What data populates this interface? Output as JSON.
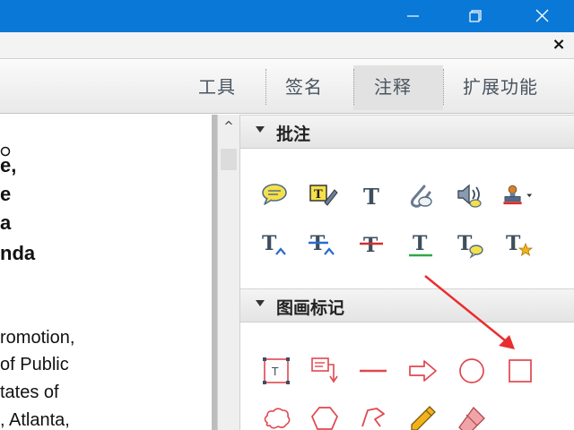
{
  "window": {
    "minimize_label": "—",
    "maximize_label": "⧉",
    "close_label": "✕"
  },
  "document_tab": {
    "close_label": "×"
  },
  "toolbar": {
    "tabs": [
      {
        "label": "工具"
      },
      {
        "label": "签名"
      },
      {
        "label": "注释"
      },
      {
        "label": "扩展功能"
      }
    ],
    "active_tab": "注释"
  },
  "document": {
    "lines": [
      "e,",
      "e",
      "a",
      "nda",
      "romotion,",
      "of Public",
      "tates of",
      ", Atlanta,"
    ]
  },
  "scrollbar": {
    "up_label": "^"
  },
  "panel": {
    "annotations": {
      "title": "批注",
      "tools": [
        {
          "icon": "sticky-note-icon"
        },
        {
          "icon": "highlight-text-icon"
        },
        {
          "icon": "add-text-icon"
        },
        {
          "icon": "attach-file-icon"
        },
        {
          "icon": "record-audio-icon"
        },
        {
          "icon": "stamp-icon"
        },
        {
          "icon": "insert-text-icon"
        },
        {
          "icon": "replace-text-icon"
        },
        {
          "icon": "strikethrough-icon"
        },
        {
          "icon": "underline-icon"
        },
        {
          "icon": "add-note-to-text-icon"
        },
        {
          "icon": "text-favorite-icon"
        }
      ]
    },
    "drawing_markups": {
      "title": "图画标记",
      "tools": [
        {
          "icon": "text-box-icon"
        },
        {
          "icon": "callout-icon"
        },
        {
          "icon": "line-icon"
        },
        {
          "icon": "arrow-icon"
        },
        {
          "icon": "oval-icon"
        },
        {
          "icon": "rectangle-icon"
        },
        {
          "icon": "cloud-icon"
        },
        {
          "icon": "polygon-icon"
        },
        {
          "icon": "connected-lines-icon"
        },
        {
          "icon": "pencil-icon"
        },
        {
          "icon": "eraser-icon"
        }
      ]
    }
  },
  "colors": {
    "titlebar": "#0a78d7",
    "markup_red": "#e0474f",
    "annotation_arrow": "#ea2d2d"
  }
}
